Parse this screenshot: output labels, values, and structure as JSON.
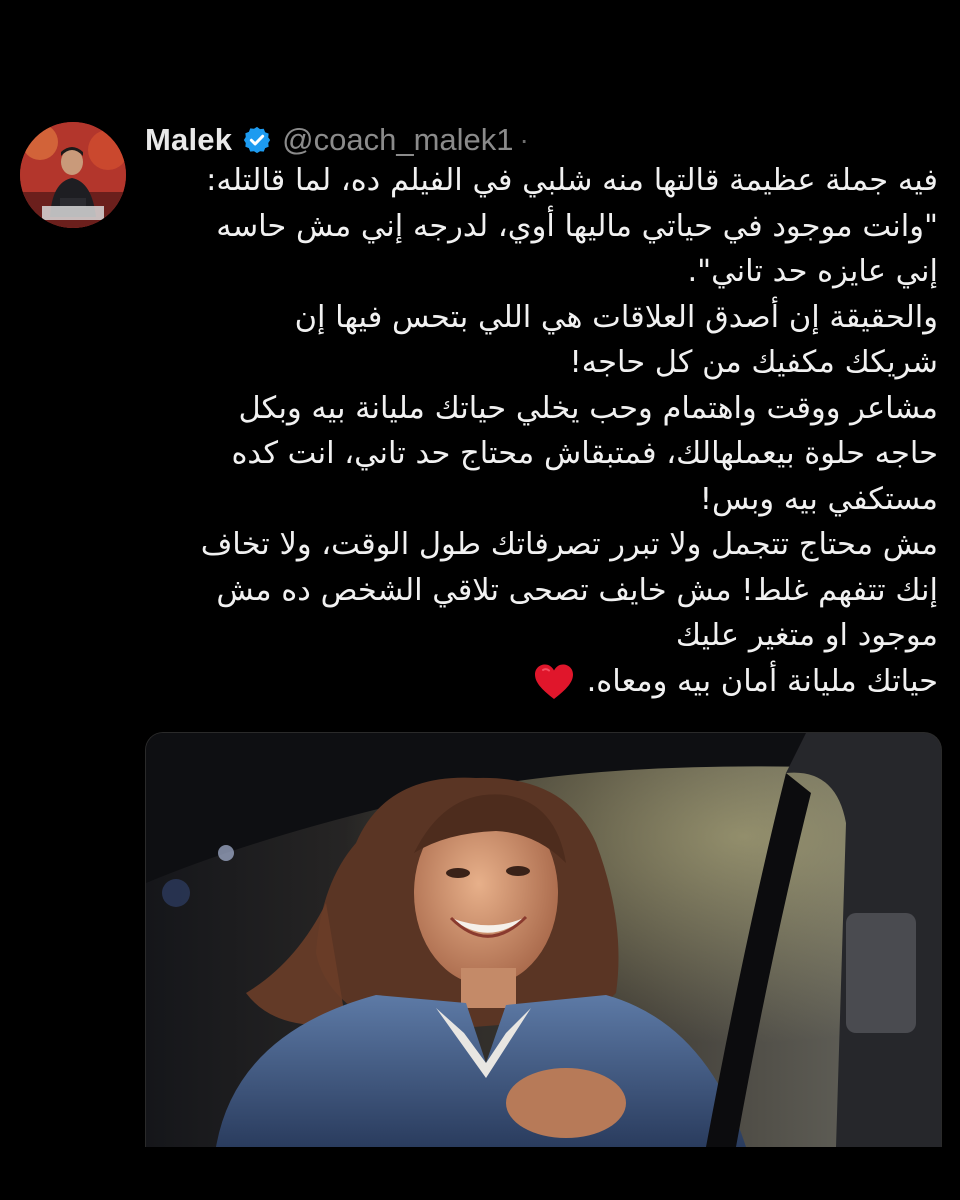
{
  "tweet": {
    "author_name": "Malek",
    "handle": "@coach_malek1",
    "separator": "·",
    "verified": true,
    "verified_color": "#1d9bf0",
    "text_lines": [
      "فيه جملة عظيمة قالتها منه شلبي في الفيلم ده، لما قالتله:",
      "\"وانت موجود في حياتي ماليها أوي، لدرجه إني مش حاسه",
      "إني عايزه حد تاني\".",
      "والحقيقة إن أصدق العلاقات هي اللي بتحس فيها إن",
      "شريكك مكفيك من كل حاجه!",
      "مشاعر ووقت واهتمام وحب يخلي حياتك مليانة بيه وبكل",
      "حاجه حلوة بيعملهالك، فمتبقاش محتاج حد تاني، انت كده",
      "مستكفي بيه وبس!",
      "مش محتاج تتجمل ولا تبرر تصرفاتك طول الوقت، ولا تخاف",
      "إنك تتفهم غلط! مش خايف تصحى تلاقي الشخص ده مش",
      "موجود او متغير عليك",
      "حياتك مليانة أمان بيه ومعاه."
    ],
    "end_icon": "red-heart-icon",
    "heart_color": "#e0162b",
    "media_icon": "movie-still-photo"
  }
}
